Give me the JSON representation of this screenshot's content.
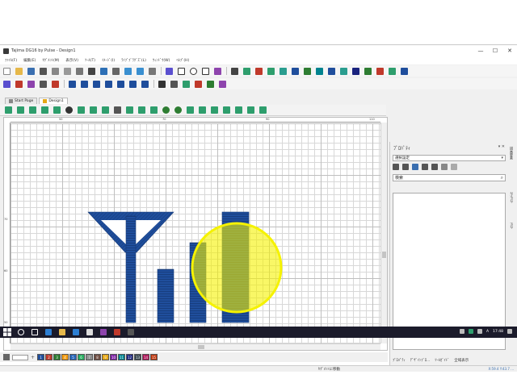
{
  "window": {
    "title": "Tajima DG16 by Pulse - Design1",
    "min_glyph": "—",
    "max_glyph": "☐",
    "close_glyph": "✕"
  },
  "menu": [
    "ﾌｧｲﾙ(F)",
    "編集(E)",
    "ｾｸﾞﾒﾝﾄ(M)",
    "表示(V)",
    "ﾂｰﾙ(T)",
    "ｲﾒｰｼﾞ(I)",
    "ﾗｲﾌﾞﾌﾞﾗｸﾞｽﾞ(L)",
    "ｳｨﾝﾄﾞｳ(W)",
    "ﾍﾙﾌﾟ(H)"
  ],
  "tabs": [
    {
      "label": "Start Page",
      "active": false
    },
    {
      "label": "Design1",
      "active": true
    }
  ],
  "ruler": {
    "top": [
      "50",
      "70",
      "90",
      "110"
    ],
    "left": [
      "70",
      "60",
      "50"
    ]
  },
  "colorbar": {
    "swatches": [
      {
        "num": "1",
        "color": "#1f4e9c"
      },
      {
        "num": "2",
        "color": "#c0392b"
      },
      {
        "num": "3",
        "color": "#2e7d32"
      },
      {
        "num": "4",
        "color": "#f39c12"
      },
      {
        "num": "5",
        "color": "#2966b8"
      },
      {
        "num": "6",
        "color": "#27ae60"
      },
      {
        "num": "7",
        "color": "#8e8e8e"
      },
      {
        "num": "8",
        "color": "#6d4c41"
      },
      {
        "num": "9",
        "color": "#e6a817"
      },
      {
        "num": "10",
        "color": "#7b1fa2"
      },
      {
        "num": "11",
        "color": "#00838f"
      },
      {
        "num": "12",
        "color": "#1a237e"
      },
      {
        "num": "13",
        "color": "#37474f"
      },
      {
        "num": "14",
        "color": "#ad1457"
      },
      {
        "num": "15",
        "color": "#bf360c"
      }
    ]
  },
  "properties": {
    "title": "ﾌﾟﾛﾊﾟﾃｨ",
    "controls": "▾ ✕",
    "selection": "選択設定",
    "search_placeholder": "検索",
    "bottom_tabs": [
      "ﾌﾟﾛﾊﾟﾃｨ",
      "ﾃﾞｻﾞｲﾝﾌﾞﾛ...",
      "ﾂｰﾙｶﾞｲﾄﾞ",
      "全域表示"
    ],
    "side_tabs": [
      "描画要素",
      "ｽﾃｯﾁﾘｽﾄ",
      "ﾃｷｽﾄ"
    ]
  },
  "status": {
    "text": "ｾｸﾞﾒﾝﾄに移動",
    "coord": "X:59.4 Y:43.7 ..."
  },
  "taskbar": {
    "time": "17:48",
    "lang": "A"
  },
  "colors": {
    "accent": "#1f4e9c",
    "highlight": "#f5f200"
  }
}
